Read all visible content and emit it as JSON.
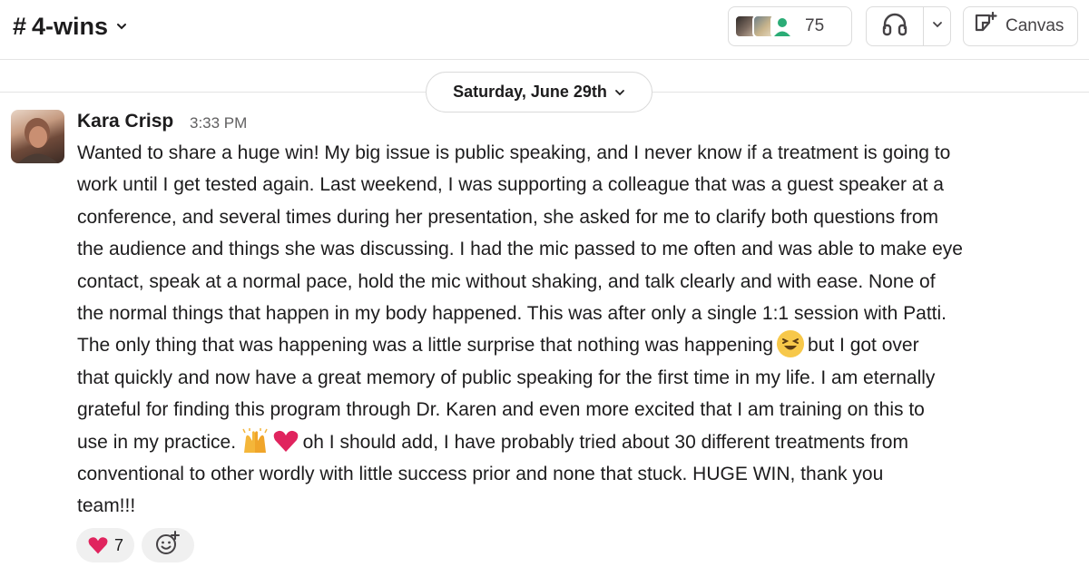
{
  "header": {
    "channel_hash": "#",
    "channel_name": "4-wins",
    "member_count": "75",
    "canvas_label": "Canvas"
  },
  "date_divider": {
    "label": "Saturday, June 29th"
  },
  "message": {
    "author": "Kara Crisp",
    "time": "3:33 PM",
    "lines": [
      "Wanted to share a huge win! My big issue is public speaking, and I never know if a treatment is going to",
      "work until I get tested again. Last weekend, I was supporting a colleague that was a guest speaker at a",
      "conference, and several times during her presentation, she asked for me to clarify both questions from",
      "the audience and things she was discussing. I had the mic passed to me often and was able to make eye",
      "contact, speak at a normal pace, hold the mic without shaking, and talk clearly and with ease. None of",
      "the normal things that happen in my body happened. This was after only a single 1:1 session with Patti.",
      "The only thing that was happening was a little surprise that nothing was happening",
      "but I got over",
      "that quickly and now have a great memory of public speaking for the first time in my life. I am eternally",
      "grateful for finding this program through Dr. Karen and even more excited that I am training on this to",
      "use in my practice.",
      "oh I should add, I have probably tried about 30 different treatments from",
      "conventional to other wordly with little success prior and none that stuck. HUGE WIN, thank you",
      "team!!!"
    ]
  },
  "reactions": [
    {
      "emoji": "heart-emoji",
      "count": "7"
    }
  ],
  "icons": {
    "huddle": "headphones-icon",
    "canvas": "canvas-icon",
    "add_reaction": "add-reaction-icon"
  },
  "colors": {
    "heart": "#e0245e",
    "grin": "#f7c84a",
    "raise_hands": "#f4b63a"
  }
}
